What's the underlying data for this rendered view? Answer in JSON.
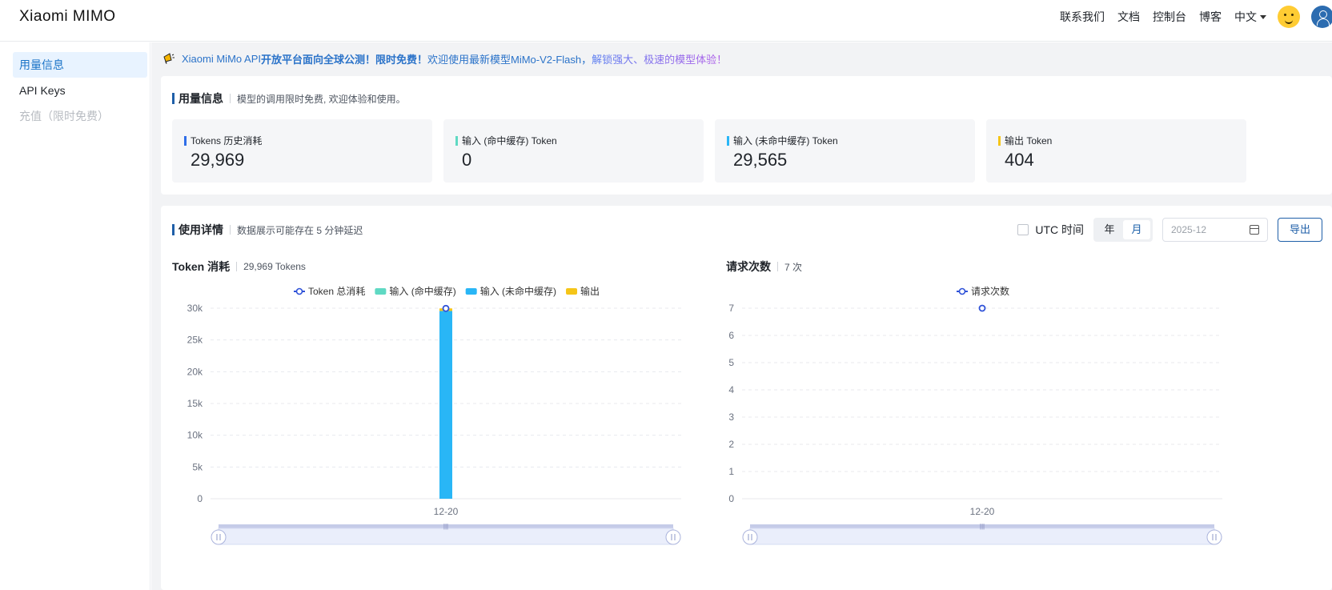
{
  "header": {
    "logo": "Xiaomi MIMO",
    "nav": [
      "联系我们",
      "文档",
      "控制台",
      "博客"
    ],
    "lang": "中文"
  },
  "sidebar": {
    "items": [
      {
        "label": "用量信息",
        "state": "active"
      },
      {
        "label": "API Keys",
        "state": "normal"
      },
      {
        "label": "充值（限时免费）",
        "state": "disabled"
      }
    ]
  },
  "banner": {
    "part1": "Xiaomi MiMo API",
    "part2": " 开放平台面向全球公测！限时免费！",
    "part3": "欢迎使用最新模型 ",
    "part4": "MiMo-V2-Flash，",
    "part5": "解锁强大、极速的模型体验！"
  },
  "usage": {
    "title": "用量信息",
    "desc": "模型的调用限时免费, 欢迎体验和使用。",
    "stats": [
      {
        "label": "Tokens 历史消耗",
        "value": "29,969",
        "color": "#2f6ee8"
      },
      {
        "label": "输入 (命中缓存) Token",
        "value": "0",
        "color": "#5fd9c3"
      },
      {
        "label": "输入 (未命中缓存) Token",
        "value": "29,565",
        "color": "#29b6f6"
      },
      {
        "label": "输出 Token",
        "value": "404",
        "color": "#f5c518"
      }
    ]
  },
  "details": {
    "title": "使用详情",
    "desc": "数据展示可能存在 5 分钟延迟",
    "utc_label": "UTC 时间",
    "seg": [
      {
        "label": "年",
        "active": false
      },
      {
        "label": "月",
        "active": true
      }
    ],
    "date_value": "2025-12",
    "export_label": "导出"
  },
  "chart_data": [
    {
      "type": "bar",
      "title": "Token 消耗",
      "subtitle": "29,969 Tokens",
      "categories": [
        "12-20"
      ],
      "series": [
        {
          "name": "Token 总消耗",
          "kind": "line",
          "color": "#2f52d8",
          "values": [
            29969
          ]
        },
        {
          "name": "输入 (命中缓存)",
          "kind": "bar",
          "color": "#5fd9c3",
          "values": [
            0
          ]
        },
        {
          "name": "输入 (未命中缓存)",
          "kind": "bar",
          "color": "#29b6f6",
          "values": [
            29565
          ]
        },
        {
          "name": "输出",
          "kind": "bar",
          "color": "#f5c518",
          "values": [
            404
          ]
        }
      ],
      "yticks": [
        "0",
        "5k",
        "10k",
        "15k",
        "20k",
        "25k",
        "30k"
      ],
      "ylim": [
        0,
        30000
      ],
      "grid": true,
      "legend": "top-center"
    },
    {
      "type": "line",
      "title": "请求次数",
      "subtitle": "7 次",
      "categories": [
        "12-20"
      ],
      "series": [
        {
          "name": "请求次数",
          "kind": "line",
          "color": "#2f52d8",
          "values": [
            7
          ]
        }
      ],
      "yticks": [
        "0",
        "1",
        "2",
        "3",
        "4",
        "5",
        "6",
        "7"
      ],
      "ylim": [
        0,
        7
      ],
      "grid": true,
      "legend": "top-center"
    }
  ]
}
